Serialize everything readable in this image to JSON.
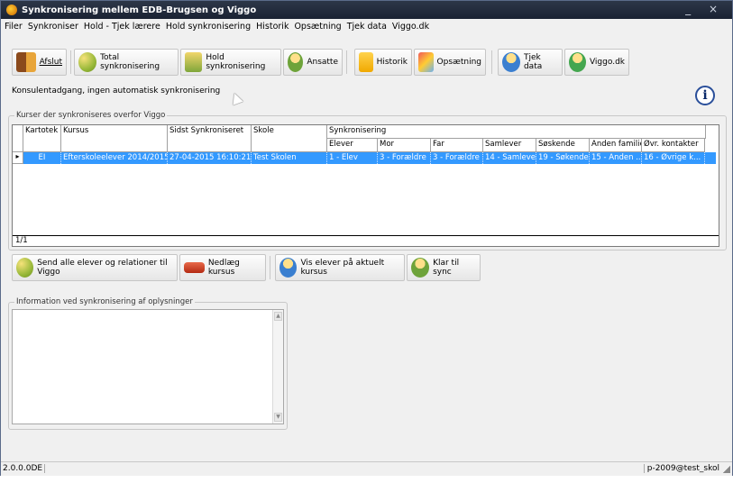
{
  "window": {
    "title": "Synkronisering mellem EDB-Brugsen og Viggo",
    "controls": "_ ×"
  },
  "menu": [
    "Filer",
    "Synkroniser",
    "Hold - Tjek lærere",
    "Hold synkronisering",
    "Historik",
    "Opsætning",
    "Tjek data",
    "Viggo.dk"
  ],
  "toolbar": {
    "afslut": "Afslut",
    "total": "Total synkronisering",
    "hold": "Hold synkronisering",
    "ansatte": "Ansatte",
    "historik": "Historik",
    "opsaetning": "Opsætning",
    "tjek": "Tjek data",
    "viggo": "Viggo.dk"
  },
  "status_message": "Konsulentadgang, ingen automatisk synkronisering",
  "info_glyph": "i",
  "courses_group": {
    "label": "Kurser der synkroniseres overfor Viggo",
    "headers": {
      "kartotek": "Kartotek",
      "kursus": "Kursus",
      "sidst": "Sidst Synkroniseret",
      "skole": "Skole",
      "sync": "Synkronisering",
      "elever": "Elever",
      "mor": "Mor",
      "far": "Far",
      "samlever": "Samlever",
      "soskende": "Søskende",
      "anden": "Anden familie",
      "ovr": "Øvr. kontakter"
    },
    "row": {
      "kartotek": "EI",
      "kursus": "Efterskoleelever 2014/2015",
      "sidst": "27-04-2015 16:10:21",
      "skole": "Test Skolen",
      "elever": "1 - Elev",
      "mor": "3 - Forældre",
      "far": "3 - Forældre",
      "samlever": "14 - Samlever",
      "soskende": "19 - Søkende",
      "anden": "15 - Anden ...",
      "ovr": "16 - Øvrige k..."
    },
    "row_indicator": "▸",
    "footer": "1/1"
  },
  "actions": {
    "send": "Send alle elever og relationer til Viggo",
    "nedlaeg": "Nedlæg kursus",
    "vis": "Vis elever på aktuelt kursus",
    "klar": "Klar til sync"
  },
  "info_group": {
    "label": "Information ved synkronisering af oplysninger"
  },
  "statusbar": {
    "version": "2.0.0.0DE",
    "user": "p-2009@test_skol"
  }
}
